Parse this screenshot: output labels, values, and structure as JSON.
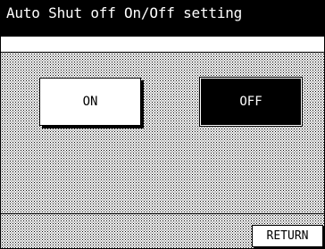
{
  "header": {
    "title": "Auto Shut off On/Off setting"
  },
  "options": {
    "on_label": "ON",
    "off_label": "OFF",
    "selected": "OFF"
  },
  "footer": {
    "return_label": "RETURN"
  },
  "colors": {
    "title_bar": "#000000",
    "title_text": "#ffffff",
    "selected_button": "#000000",
    "unselected_button": "#ffffff"
  }
}
